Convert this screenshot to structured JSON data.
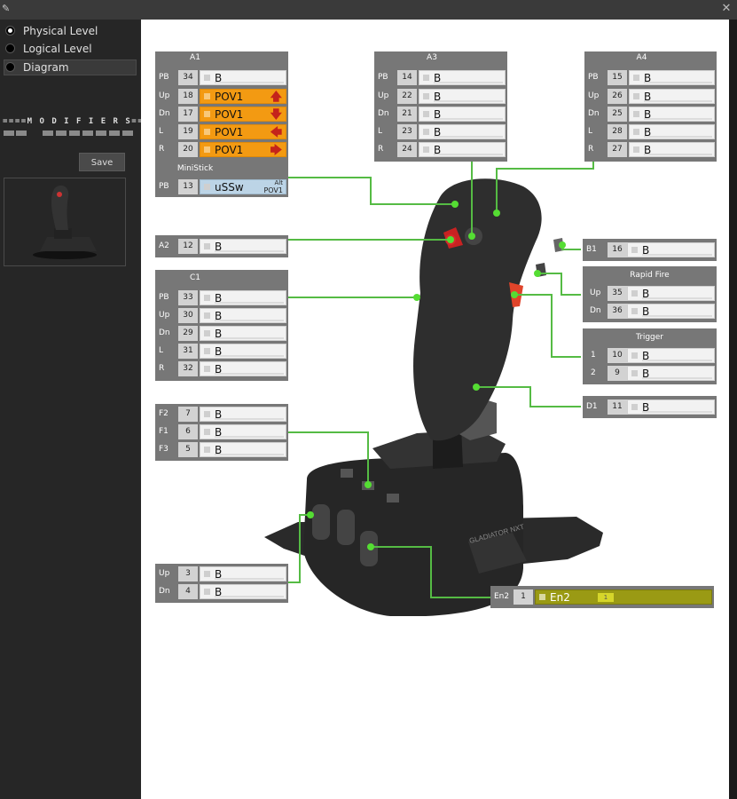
{
  "window": {
    "close_icon_glyph": "✕"
  },
  "sidebar": {
    "views": [
      {
        "label": "Physical Level",
        "selected": true
      },
      {
        "label": "Logical Level",
        "selected": false
      },
      {
        "label": "Diagram",
        "selected": false
      }
    ],
    "modifiers_label": "====M O D I F I E R S====",
    "save_label": "Save"
  },
  "colors": {
    "accent_green": "#55bb44",
    "panel_gray": "#777777",
    "pov_orange": "#f39a12",
    "alt_blue": "#bcd4e6",
    "encoder_olive": "#9a9a14"
  },
  "panels": {
    "a1": {
      "title": "A1",
      "rows": [
        {
          "label": "PB",
          "num": "34",
          "value": "B"
        },
        {
          "label": "Up",
          "num": "18",
          "value": "POV1",
          "icon": "arrow-up-icon"
        },
        {
          "label": "Dn",
          "num": "17",
          "value": "POV1",
          "icon": "arrow-down-icon"
        },
        {
          "label": "L",
          "num": "19",
          "value": "POV1",
          "icon": "arrow-left-icon"
        },
        {
          "label": "R",
          "num": "20",
          "value": "POV1",
          "icon": "arrow-right-icon"
        }
      ]
    },
    "ministick": {
      "title": "MiniStick",
      "rows": [
        {
          "label": "PB",
          "num": "13",
          "value": "uSSw",
          "alt": "Alt",
          "pov": "POV1"
        }
      ]
    },
    "a3": {
      "title": "A3",
      "rows": [
        {
          "label": "PB",
          "num": "14",
          "value": "B"
        },
        {
          "label": "Up",
          "num": "22",
          "value": "B"
        },
        {
          "label": "Dn",
          "num": "21",
          "value": "B"
        },
        {
          "label": "L",
          "num": "23",
          "value": "B"
        },
        {
          "label": "R",
          "num": "24",
          "value": "B"
        }
      ]
    },
    "a4": {
      "title": "A4",
      "rows": [
        {
          "label": "PB",
          "num": "15",
          "value": "B"
        },
        {
          "label": "Up",
          "num": "26",
          "value": "B"
        },
        {
          "label": "Dn",
          "num": "25",
          "value": "B"
        },
        {
          "label": "L",
          "num": "28",
          "value": "B"
        },
        {
          "label": "R",
          "num": "27",
          "value": "B"
        }
      ]
    },
    "a2": {
      "rows": [
        {
          "label": "A2",
          "num": "12",
          "value": "B"
        }
      ]
    },
    "b1": {
      "rows": [
        {
          "label": "B1",
          "num": "16",
          "value": "B"
        }
      ]
    },
    "rapid_fire": {
      "title": "Rapid Fire",
      "rows": [
        {
          "label": "Up",
          "num": "35",
          "value": "B"
        },
        {
          "label": "Dn",
          "num": "36",
          "value": "B"
        }
      ]
    },
    "c1": {
      "title": "C1",
      "rows": [
        {
          "label": "PB",
          "num": "33",
          "value": "B"
        },
        {
          "label": "Up",
          "num": "30",
          "value": "B"
        },
        {
          "label": "Dn",
          "num": "29",
          "value": "B"
        },
        {
          "label": "L",
          "num": "31",
          "value": "B"
        },
        {
          "label": "R",
          "num": "32",
          "value": "B"
        }
      ]
    },
    "trigger": {
      "title": "Trigger",
      "rows": [
        {
          "label": "1",
          "num": "10",
          "value": "B"
        },
        {
          "label": "2",
          "num": "9",
          "value": "B"
        }
      ]
    },
    "d1": {
      "rows": [
        {
          "label": "D1",
          "num": "11",
          "value": "B"
        }
      ]
    },
    "f_buttons": {
      "rows": [
        {
          "label": "F2",
          "num": "7",
          "value": "B"
        },
        {
          "label": "F1",
          "num": "6",
          "value": "B"
        },
        {
          "label": "F3",
          "num": "5",
          "value": "B"
        }
      ]
    },
    "wheel": {
      "rows": [
        {
          "label": "Up",
          "num": "3",
          "value": "B"
        },
        {
          "label": "Dn",
          "num": "4",
          "value": "B"
        }
      ]
    },
    "en2": {
      "rows": [
        {
          "label": "En2",
          "num": "1",
          "value": "En2",
          "badge": "1"
        }
      ]
    }
  },
  "device": {
    "brand_text": "GLADIATOR NXT"
  }
}
